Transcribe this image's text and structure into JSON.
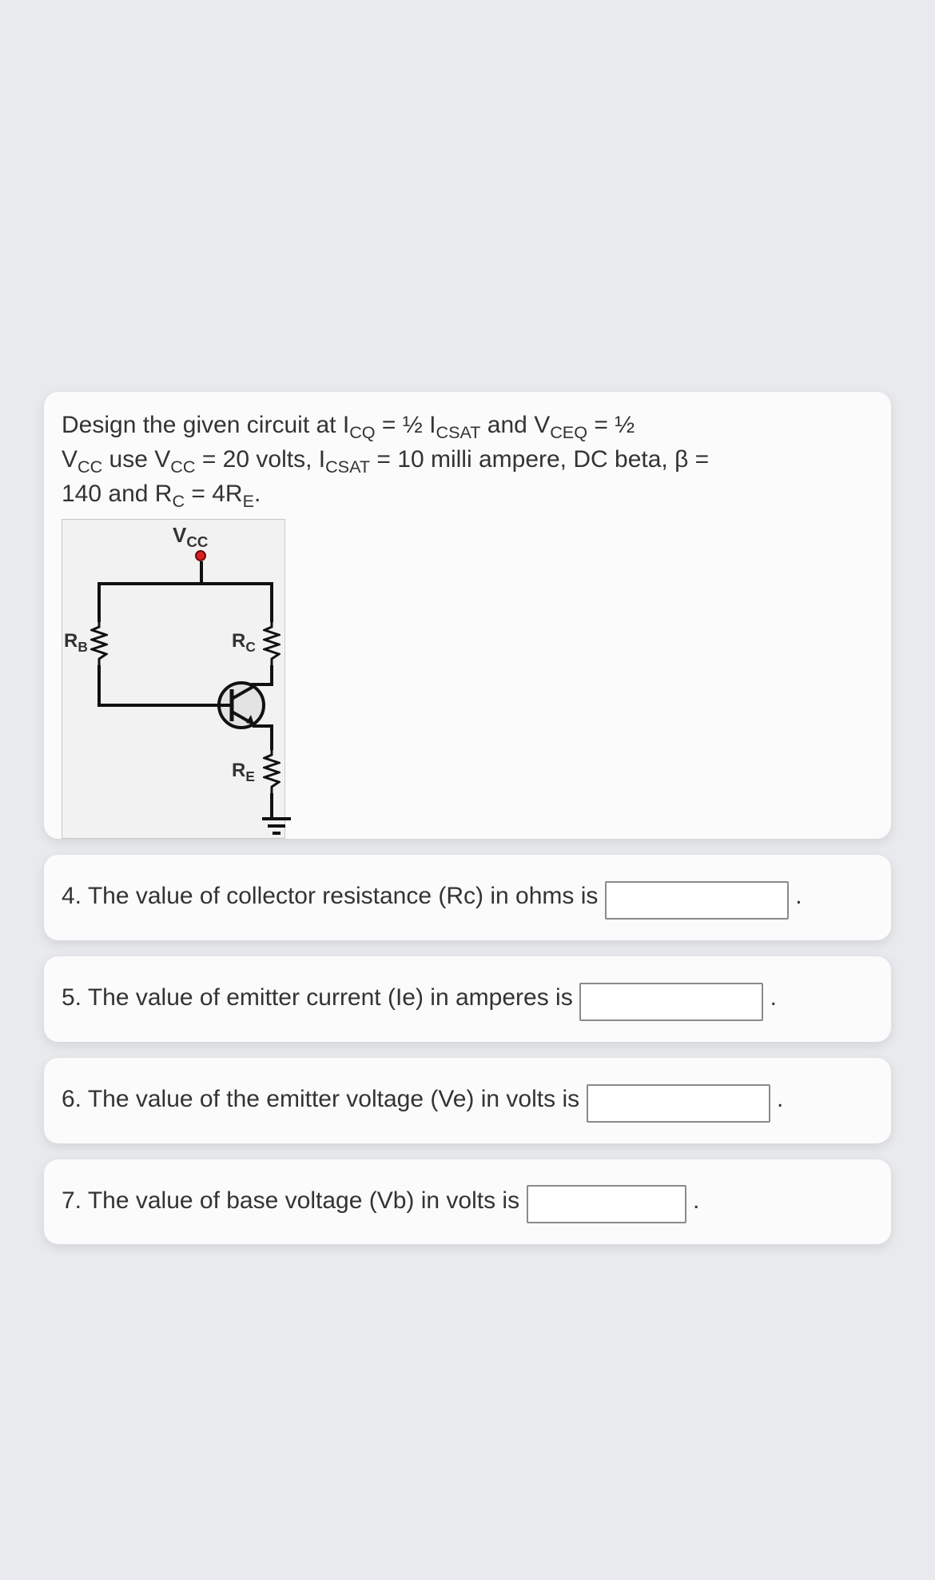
{
  "problem": {
    "line1_a": "Design the given circuit at I",
    "line1_sub_cq": "CQ",
    "line1_b": " = ½ I",
    "line1_sub_csat": "CSAT",
    "line1_c": " and V",
    "line1_sub_ceq": "CEQ",
    "line1_d": " = ½",
    "line2_a": "V",
    "line2_sub_cc1": "CC",
    "line2_b": " use V",
    "line2_sub_cc2": "CC",
    "line2_c": " = 20 volts,  I",
    "line2_sub_csat2": "CSAT",
    "line2_d": " = 10 milli ampere, DC beta, β =",
    "line3_a": "140 and R",
    "line3_sub_c": "C",
    "line3_b": " = 4R",
    "line3_sub_e": "E",
    "line3_c": "."
  },
  "diagram": {
    "vcc": "V",
    "vcc_sub": "CC",
    "rb": "R",
    "rb_sub": "B",
    "rc": "R",
    "rc_sub": "C",
    "re": "R",
    "re_sub": "E"
  },
  "questions": {
    "q4": "4. The value of collector resistance (Rc) in ohms is",
    "q5": "5. The value of emitter current (Ie) in amperes is",
    "q6": "6. The value of the emitter voltage (Ve) in volts is",
    "q7": "7. The value of base voltage (Vb) in volts is",
    "period": "."
  },
  "answers": {
    "q4": "",
    "q5": "",
    "q6": "",
    "q7": ""
  }
}
